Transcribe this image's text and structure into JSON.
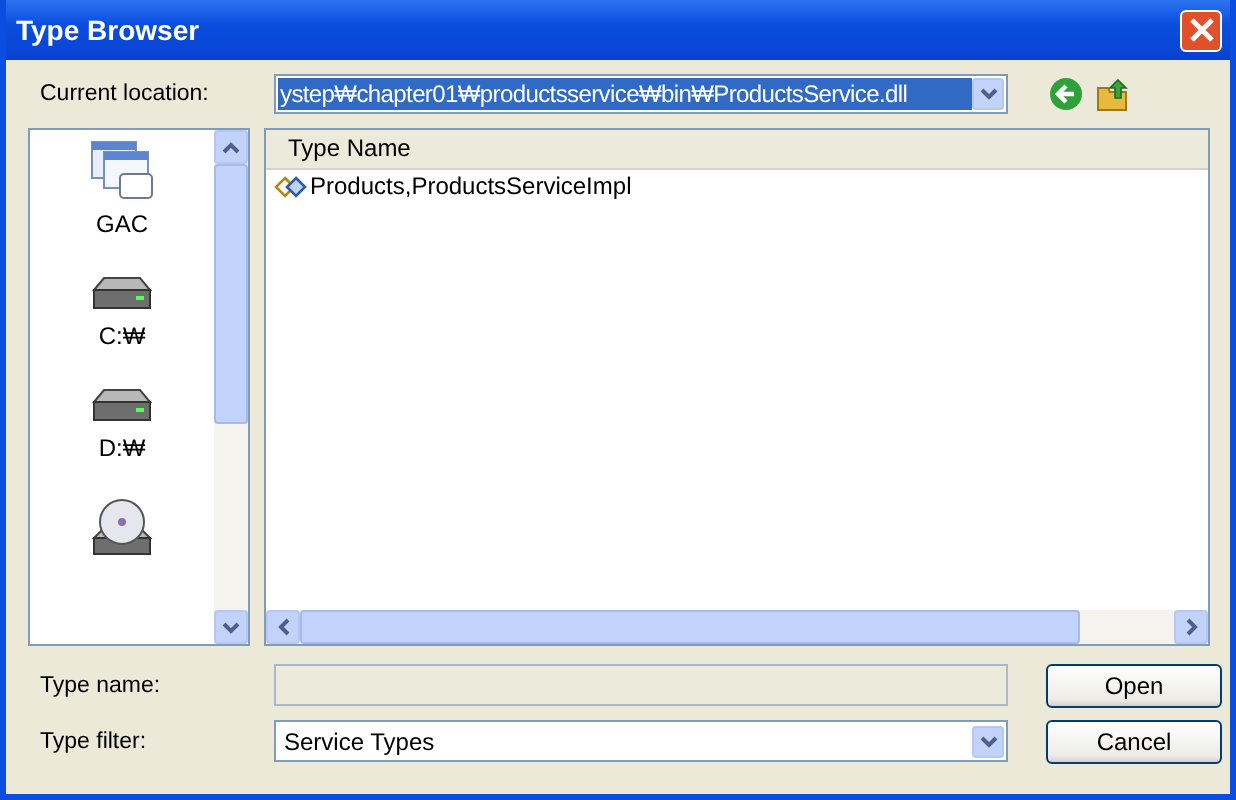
{
  "window": {
    "title": "Type Browser"
  },
  "location": {
    "label": "Current location:",
    "value": "ystep₩chapter01₩productsservice₩bin₩ProductsService.dll"
  },
  "places": [
    {
      "kind": "gac",
      "label": "GAC"
    },
    {
      "kind": "drive",
      "label": "C:₩"
    },
    {
      "kind": "drive",
      "label": "D:₩"
    },
    {
      "kind": "cdrom"
    }
  ],
  "table": {
    "columns": [
      "Type Name"
    ],
    "rows": [
      "Products,ProductsServiceImpl"
    ]
  },
  "type_name": {
    "label": "Type name:",
    "disabled": true
  },
  "type_filter": {
    "label": "Type filter:",
    "value": "Service Types"
  },
  "buttons": [
    "Open",
    "Cancel"
  ]
}
